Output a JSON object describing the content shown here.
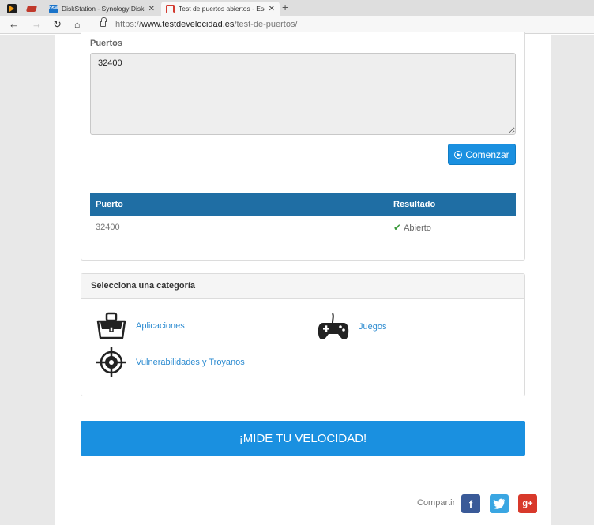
{
  "browser": {
    "tabs": [
      {
        "title": "DiskStation - Synology DiskStation",
        "favicon": "dsm-icon"
      },
      {
        "title": "Test de puertos abiertos - Escaner",
        "favicon": "speedometer-icon"
      }
    ],
    "dsm_favicon_text": "DSM",
    "new_tab_symbol": "+",
    "url_prefix": "https://",
    "url_host": "www.testdevelocidad.es",
    "url_path": "/test-de-puertos/"
  },
  "ports": {
    "label": "Puertos",
    "value": "32400",
    "start_label": "Comenzar"
  },
  "results": {
    "headers": [
      "Puerto",
      "Resultado"
    ],
    "rows": [
      {
        "port": "32400",
        "result": "Abierto",
        "status": "open"
      }
    ]
  },
  "categories": {
    "title": "Selecciona una categoría",
    "items": [
      {
        "label": "Aplicaciones",
        "icon": "briefcase-icon"
      },
      {
        "label": "Juegos",
        "icon": "gamepad-icon"
      },
      {
        "label": "Vulnerabilidades y Troyanos",
        "icon": "crosshair-icon"
      }
    ]
  },
  "speed_button": "¡MIDE TU VELOCIDAD!",
  "share": {
    "label": "Compartir",
    "networks": [
      "f",
      "+"
    ]
  },
  "colors": {
    "accent": "#1a90e0",
    "table_header": "#1f6ea4",
    "link": "#2a8ad0",
    "facebook": "#3a5a98",
    "twitter": "#3aa6e2",
    "google_plus": "#d8392b"
  }
}
